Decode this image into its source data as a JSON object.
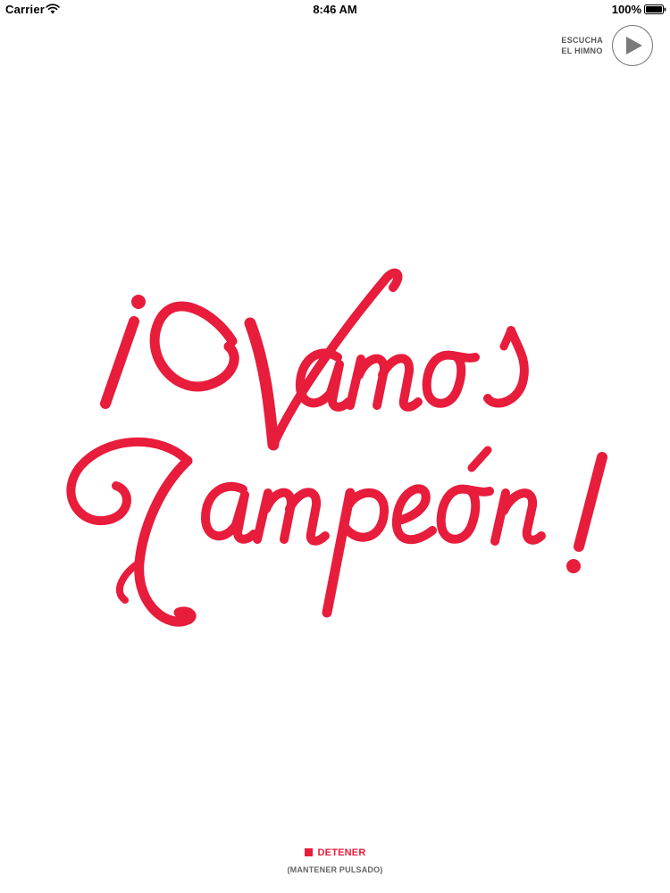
{
  "status_bar": {
    "carrier": "Carrier",
    "time": "8:46 AM",
    "battery": "100%"
  },
  "anthem": {
    "line1": "ESCUCHA",
    "line2": "EL HIMNO",
    "icon": "play-icon"
  },
  "hero": {
    "line1": "¡Vamos",
    "line2": "Campeón!",
    "color": "#e81c3b"
  },
  "stop": {
    "label": "DETENER",
    "hint": "(MANTENER PULSADO)",
    "icon": "stop-icon"
  }
}
